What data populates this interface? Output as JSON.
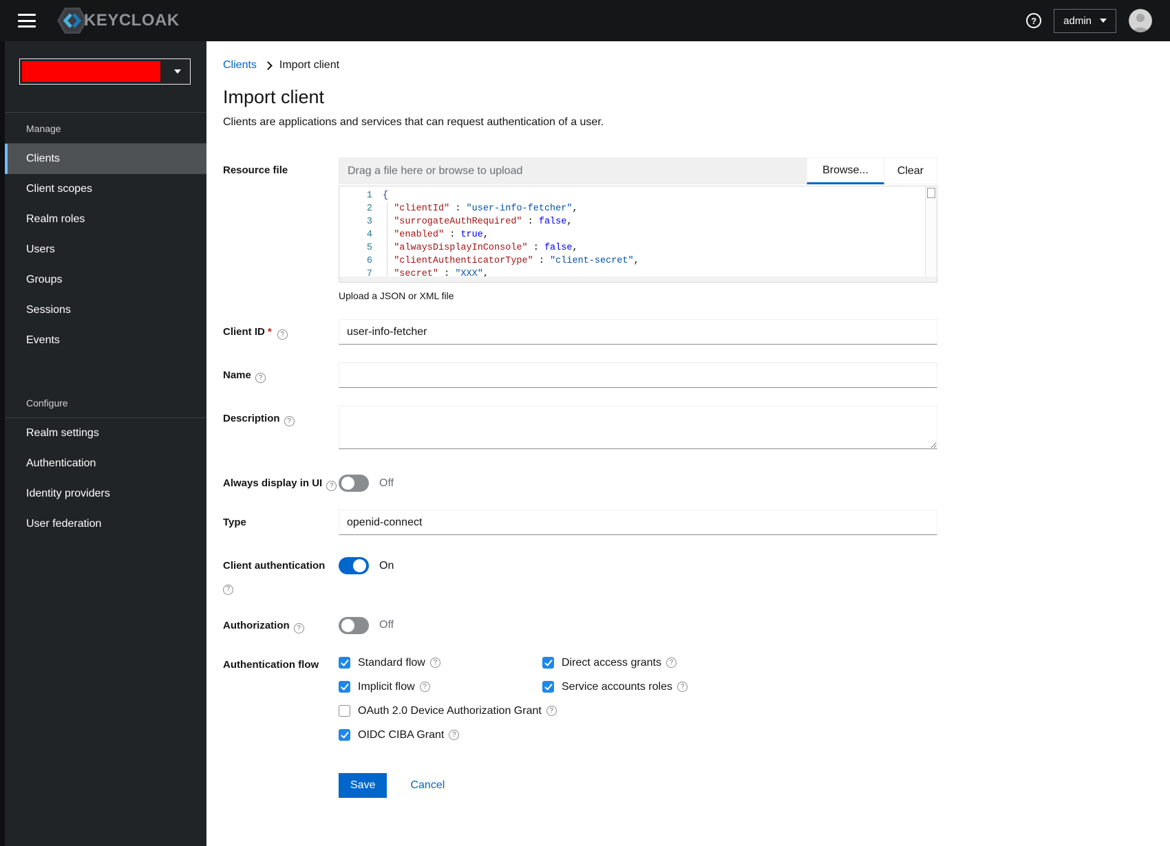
{
  "masthead": {
    "brand": "KEYCLOAK",
    "user": "admin"
  },
  "sidebar": {
    "manage": {
      "title": "Manage",
      "items": [
        "Clients",
        "Client scopes",
        "Realm roles",
        "Users",
        "Groups",
        "Sessions",
        "Events"
      ],
      "active_item": "Clients"
    },
    "configure": {
      "title": "Configure",
      "items": [
        "Realm settings",
        "Authentication",
        "Identity providers",
        "User federation"
      ]
    }
  },
  "breadcrumb": {
    "parent": "Clients",
    "current": "Import client"
  },
  "page": {
    "title": "Import client",
    "subtitle": "Clients are applications and services that can request authentication of a user."
  },
  "form": {
    "resource_file": {
      "label": "Resource file",
      "placeholder": "Drag a file here or browse to upload",
      "browse_label": "Browse...",
      "clear_label": "Clear",
      "helper": "Upload a JSON or XML file",
      "editor_lines": [
        {
          "num": "1",
          "open": "{"
        },
        {
          "num": "2",
          "key": "\"clientId\"",
          "sep": " : ",
          "str": "\"user-info-fetcher\"",
          "comma": ","
        },
        {
          "num": "3",
          "key": "\"surrogateAuthRequired\"",
          "sep": " : ",
          "bool": "false",
          "comma": ","
        },
        {
          "num": "4",
          "key": "\"enabled\"",
          "sep": " : ",
          "bool": "true",
          "comma": ","
        },
        {
          "num": "5",
          "key": "\"alwaysDisplayInConsole\"",
          "sep": " : ",
          "bool": "false",
          "comma": ","
        },
        {
          "num": "6",
          "key": "\"clientAuthenticatorType\"",
          "sep": " : ",
          "str": "\"client-secret\"",
          "comma": ","
        },
        {
          "num": "7",
          "key": "\"secret\"",
          "sep": " : ",
          "str": "\"XXX\"",
          "comma": ","
        }
      ]
    },
    "client_id": {
      "label": "Client ID",
      "required_mark": "*",
      "value": "user-info-fetcher"
    },
    "name": {
      "label": "Name",
      "value": ""
    },
    "description": {
      "label": "Description",
      "value": ""
    },
    "always_display": {
      "label": "Always display in UI",
      "state": "Off"
    },
    "type": {
      "label": "Type",
      "value": "openid-connect"
    },
    "client_auth": {
      "label": "Client authentication",
      "state": "On"
    },
    "authorization": {
      "label": "Authorization",
      "state": "Off"
    },
    "auth_flow": {
      "label": "Authentication flow",
      "options": [
        {
          "label": "Standard flow",
          "checked": true
        },
        {
          "label": "Direct access grants",
          "checked": true
        },
        {
          "label": "Implicit flow",
          "checked": true
        },
        {
          "label": "Service accounts roles",
          "checked": true
        },
        {
          "label": "OAuth 2.0 Device Authorization Grant",
          "checked": false
        },
        {
          "label": "OIDC CIBA Grant",
          "checked": true
        }
      ]
    },
    "save_label": "Save",
    "cancel_label": "Cancel"
  },
  "colors": {
    "primary_blue": "#0066cc",
    "checkbox_blue": "#1f87e8",
    "masthead_bg": "#141618",
    "sidebar_bg": "#212427",
    "active_nav_bg": "#4f5255",
    "active_nav_accent": "#73bcf7",
    "redaction_red": "#fe0000",
    "required_red": "#c9190b"
  }
}
